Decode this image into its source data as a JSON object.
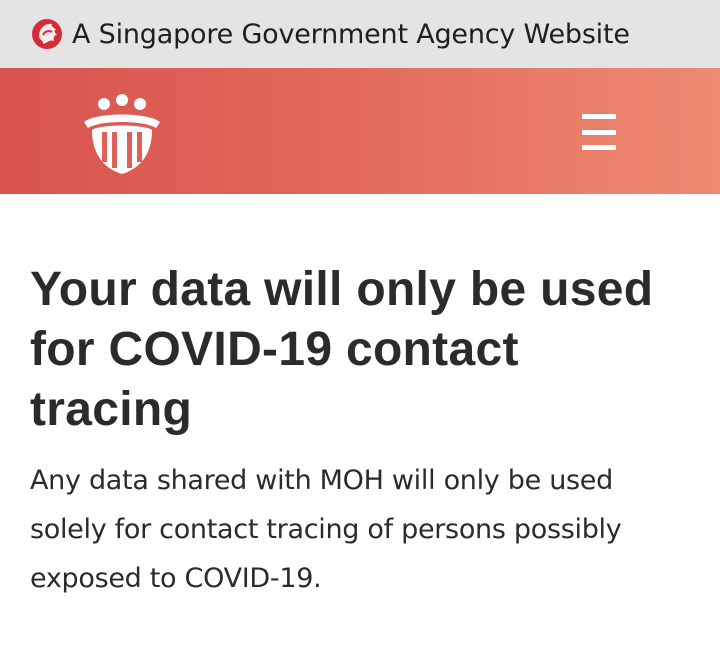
{
  "gov_banner": {
    "text": "A Singapore Government Agency Website",
    "icon": "lion-head-icon"
  },
  "header": {
    "logo_icon": "moh-logo-icon",
    "menu_icon": "hamburger-menu-icon",
    "colors": {
      "gradient_start": "#d9534f",
      "gradient_end": "#ee8a72"
    }
  },
  "main": {
    "headline": "Your data will only be used for COVID-19 contact tracing",
    "body": "Any data shared with MOH will only be used solely for contact tracing of persons possibly exposed to COVID-19."
  }
}
